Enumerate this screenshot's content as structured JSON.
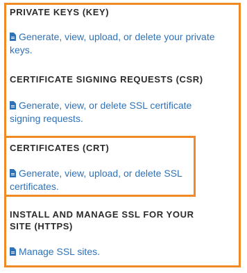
{
  "colors": {
    "frame": "#f08a24",
    "link": "#2f72b7",
    "heading": "#2b2b2b"
  },
  "sections": [
    {
      "heading": "PRIVATE KEYS (KEY)",
      "link_line1": "Generate, view, upload, or delete your private",
      "link_line2": "keys.",
      "icon": "document-icon"
    },
    {
      "heading": "CERTIFICATE SIGNING REQUESTS (CSR)",
      "link_line1": "Generate, view, or delete SSL certificate",
      "link_line2": "signing requests.",
      "icon": "document-icon"
    },
    {
      "heading": "CERTIFICATES (CRT)",
      "link_line1": "Generate, view, upload, or delete SSL",
      "link_line2": "certificates.",
      "icon": "document-icon"
    },
    {
      "heading_line1": "INSTALL AND MANAGE SSL FOR YOUR",
      "heading_line2": "SITE (HTTPS)",
      "link_line1": "Manage SSL sites.",
      "icon": "document-icon"
    }
  ]
}
